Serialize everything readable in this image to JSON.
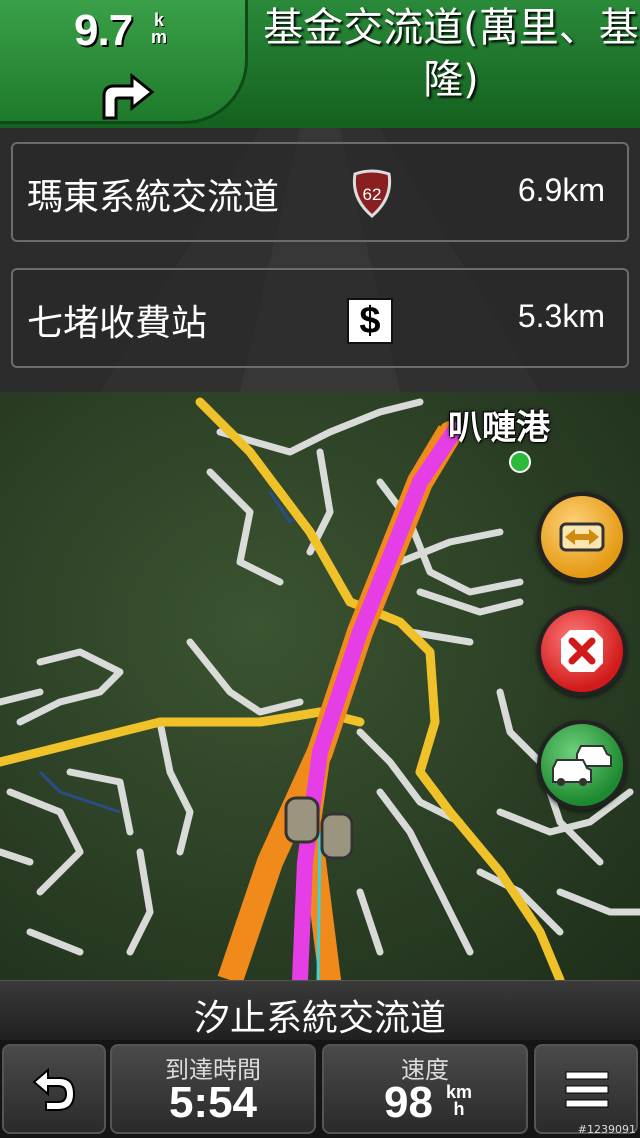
{
  "next_turn": {
    "distance": "9.7",
    "unit_top": "k",
    "unit_bottom": "m",
    "icon": "turn-right-arrow-icon",
    "road_name": "基金交流道(萬里、基隆)"
  },
  "upcoming": [
    {
      "name": "瑪東系統交流道",
      "shield": "62",
      "distance": "6.9km"
    },
    {
      "name": "七堵收費站",
      "icon": "toll-icon",
      "icon_text": "$",
      "distance": "5.3km"
    }
  ],
  "map": {
    "poi_label": "叭嗹港"
  },
  "map_buttons": {
    "detour": "detour-icon",
    "cancel": "cancel-route-icon",
    "traffic": "traffic-icon"
  },
  "street": {
    "current_name": "汐止系統交流道"
  },
  "bottom": {
    "arrival_label": "到達時間",
    "arrival_value": "5:54",
    "speed_label": "速度",
    "speed_value": "98",
    "speed_unit_top": "km",
    "speed_unit_bottom": "h",
    "back_icon": "back-icon",
    "menu_icon": "menu-icon"
  },
  "watermark": "#1239091",
  "colors": {
    "route": "#e63ee6",
    "highway": "#f0c22a",
    "top_bar": "#1e7a2b"
  }
}
